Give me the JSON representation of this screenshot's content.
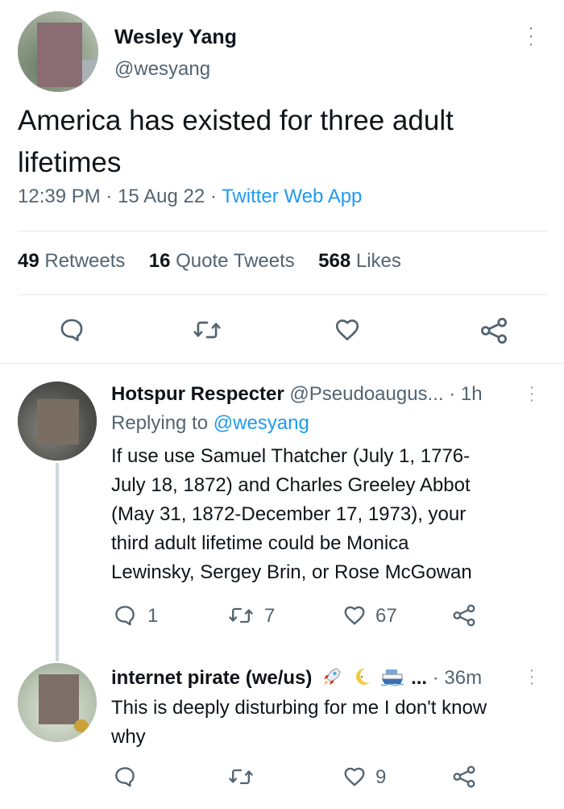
{
  "main_tweet": {
    "author_name": "Wesley Yang",
    "author_handle": "@wesyang",
    "text_line1": "America has existed for three adult",
    "text_line2": "lifetimes",
    "time": "12:39 PM",
    "sep1": "·",
    "date": "15 Aug 22",
    "sep2": "·",
    "source": "Twitter Web App",
    "stats": {
      "retweets_count": "49",
      "retweets_label": "Retweets",
      "quotes_count": "16",
      "quotes_label": "Quote Tweets",
      "likes_count": "568",
      "likes_label": "Likes"
    }
  },
  "replies": [
    {
      "author_name": "Hotspur Respecter",
      "author_handle": "@Pseudoaugus...",
      "time": "· 1h",
      "replying_prefix": "Replying to",
      "replying_to": "@wesyang",
      "lines": [
        "If use use Samuel Thatcher (July 1, 1776-",
        "July 18, 1872) and Charles Greeley Abbot",
        "(May 31, 1872-December 17, 1973), your",
        "third adult lifetime could be Monica",
        "Lewinsky, Sergey Brin, or Rose McGowan"
      ],
      "reply_count": "1",
      "retweet_count": "7",
      "like_count": "67"
    },
    {
      "author_name": "internet pirate (we/us)",
      "name_suffix": "...",
      "time": "· 36m",
      "lines": [
        "This is deeply disturbing for me I don't know",
        "why"
      ],
      "like_count": "9"
    }
  ],
  "colors": {
    "accent": "#1d9bf0",
    "text": "#0f1419",
    "muted": "#536471",
    "thread_line": "#cfd9de"
  }
}
